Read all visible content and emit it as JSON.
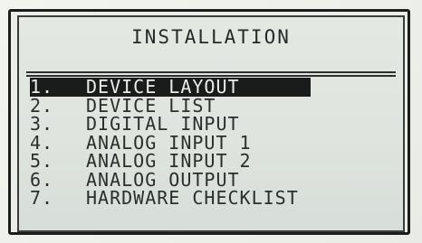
{
  "screen": {
    "title": "INSTALLATION",
    "menu": [
      {
        "number": "1.",
        "label": "DEVICE LAYOUT",
        "selected": true
      },
      {
        "number": "2.",
        "label": "DEVICE LIST",
        "selected": false
      },
      {
        "number": "3.",
        "label": "DIGITAL INPUT",
        "selected": false
      },
      {
        "number": "4.",
        "label": "ANALOG INPUT 1",
        "selected": false
      },
      {
        "number": "5.",
        "label": "ANALOG INPUT 2",
        "selected": false
      },
      {
        "number": "6.",
        "label": "ANALOG OUTPUT",
        "selected": false
      },
      {
        "number": "7.",
        "label": "HARDWARE CHECKLIST",
        "selected": false
      }
    ]
  },
  "colors": {
    "screen_background": "#e2e6e1",
    "text": "#2a2f2c",
    "highlight_background": "#1a1c1c",
    "highlight_text": "#e9ede9"
  }
}
